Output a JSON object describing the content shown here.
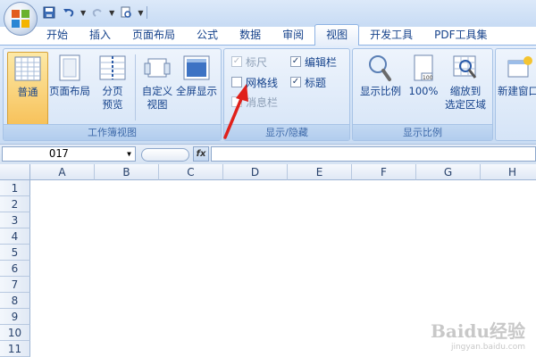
{
  "tabs": [
    "开始",
    "插入",
    "页面布局",
    "公式",
    "数据",
    "审阅",
    "视图",
    "开发工具",
    "PDF工具集"
  ],
  "active_tab": "视图",
  "workbook_views": {
    "normal": "普通",
    "page_layout": "页面布局",
    "page_break_1": "分页",
    "page_break_2": "预览",
    "custom_1": "自定义",
    "custom_2": "视图",
    "fullscreen": "全屏显示",
    "group_label": "工作簿视图"
  },
  "show_hide": {
    "ruler": {
      "label": "标尺",
      "checked": true,
      "enabled": false
    },
    "gridlines": {
      "label": "网格线",
      "checked": false,
      "enabled": true
    },
    "message_bar": {
      "label": "消息栏",
      "checked": false,
      "enabled": false
    },
    "formula_bar": {
      "label": "编辑栏",
      "checked": true,
      "enabled": true
    },
    "headings": {
      "label": "标题",
      "checked": true,
      "enabled": true
    },
    "group_label": "显示/隐藏"
  },
  "zoom": {
    "zoom": "显示比例",
    "hundred": "100%",
    "zoom_sel_1": "缩放到",
    "zoom_sel_2": "选定区域",
    "group_label": "显示比例"
  },
  "window": {
    "new_window": "新建窗口"
  },
  "formula_bar": {
    "name_box": "O17",
    "fx": "fx",
    "content": ""
  },
  "columns": [
    "A",
    "B",
    "C",
    "D",
    "E",
    "F",
    "G",
    "H"
  ],
  "rows": [
    "1",
    "2",
    "3",
    "4",
    "5",
    "6",
    "7",
    "8",
    "9",
    "10",
    "11"
  ],
  "watermark": {
    "line1": "Baidu经验",
    "line2": "jingyan.baidu.com"
  },
  "colors": {
    "arrow": "#e0201a",
    "accent": "#15428b"
  }
}
